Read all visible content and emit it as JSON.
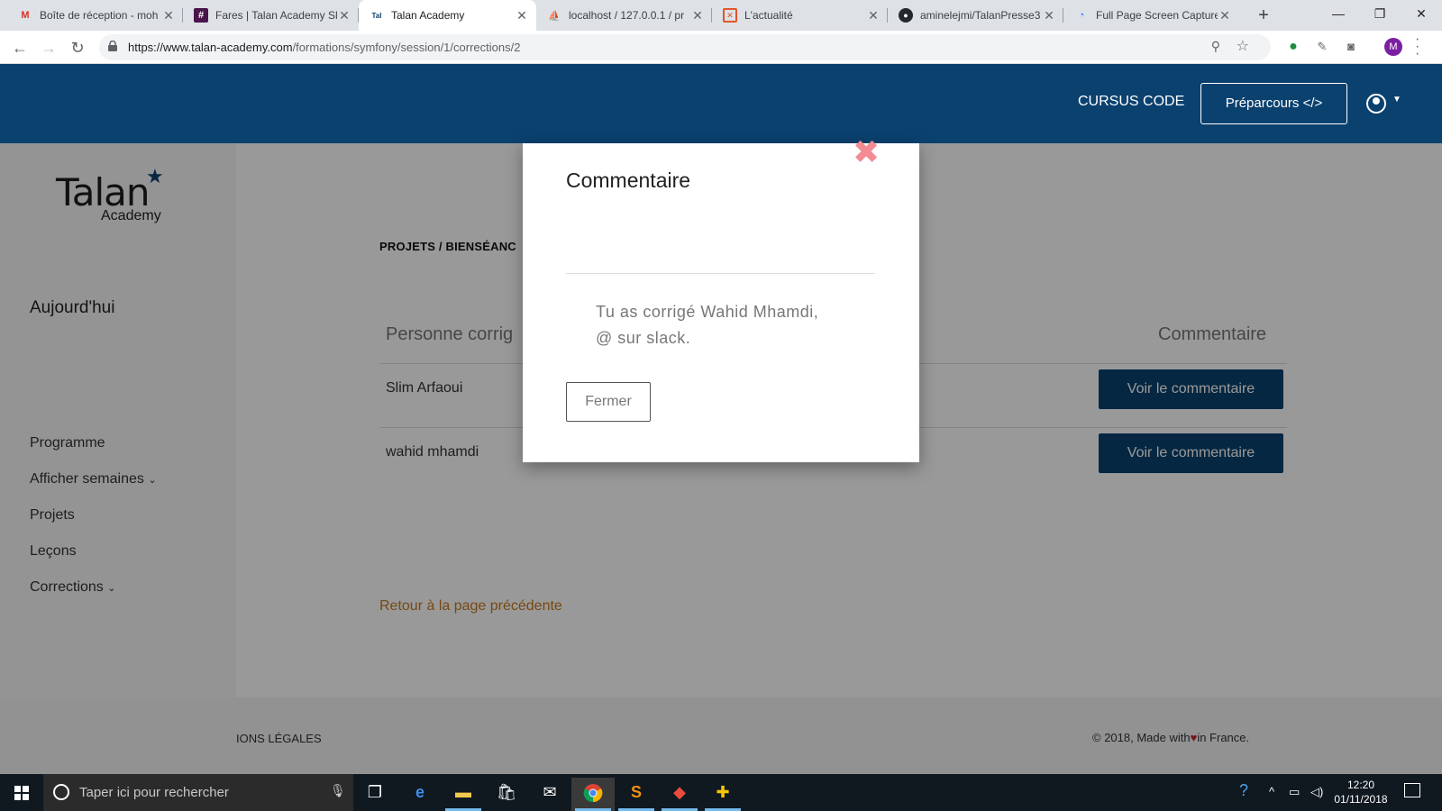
{
  "browser": {
    "tabs": [
      {
        "title": "Boîte de réception - moh",
        "icon": "gmail-icon"
      },
      {
        "title": "Fares | Talan Academy Sl",
        "icon": "slack-icon"
      },
      {
        "title": "Talan Academy",
        "icon": "talan-favicon",
        "active": true
      },
      {
        "title": "localhost / 127.0.0.1 / pr",
        "icon": "phpmyadmin-icon"
      },
      {
        "title": "L'actualité",
        "icon": "news-icon"
      },
      {
        "title": "aminelejmi/TalanPresse3",
        "icon": "github-icon"
      },
      {
        "title": "Full Page Screen Capture",
        "icon": "screen-capture-icon"
      }
    ],
    "new_tab": "+",
    "url_host": "https://www.talan-academy.com",
    "url_path": "/formations/symfony/session/1/corrections/2",
    "profile_initial": "M"
  },
  "header": {
    "cursus": "CURSUS CODE",
    "preparcours": "Préparcours </>"
  },
  "sidebar": {
    "logo_brand": "Talan",
    "logo_sub": "Academy",
    "title": "Aujourd'hui",
    "items": [
      {
        "label": "Programme"
      },
      {
        "label": "Afficher semaines",
        "chevron": true
      },
      {
        "label": "Projets"
      },
      {
        "label": "Leçons"
      },
      {
        "label": "Corrections",
        "chevron": true
      }
    ]
  },
  "main": {
    "breadcrumb": "PROJETS / BIENSÉANC",
    "columns": [
      "Personne corrig",
      "Commentaire"
    ],
    "rows": [
      {
        "person": "Slim Arfaoui",
        "action": "Voir le commentaire"
      },
      {
        "person": "wahid mhamdi",
        "action": "Voir le commentaire"
      }
    ],
    "back_link": "Retour à la page précédente"
  },
  "footer": {
    "legal": "IONS LÉGALES",
    "copyright_pre": "© 2018, Made with",
    "copyright_post": "in France."
  },
  "modal": {
    "title": "Commentaire",
    "close": "✖",
    "body_line1": "Tu as corrigé Wahid Mhamdi,",
    "body_line2": "@ sur slack.",
    "button": "Fermer"
  },
  "taskbar": {
    "search_placeholder": "Taper ici pour rechercher",
    "time": "12:20",
    "date": "01/11/2018"
  },
  "colors": {
    "brand_navy": "#0b416f",
    "link_orange": "#c77a1d",
    "close_pink": "#f28b93"
  }
}
